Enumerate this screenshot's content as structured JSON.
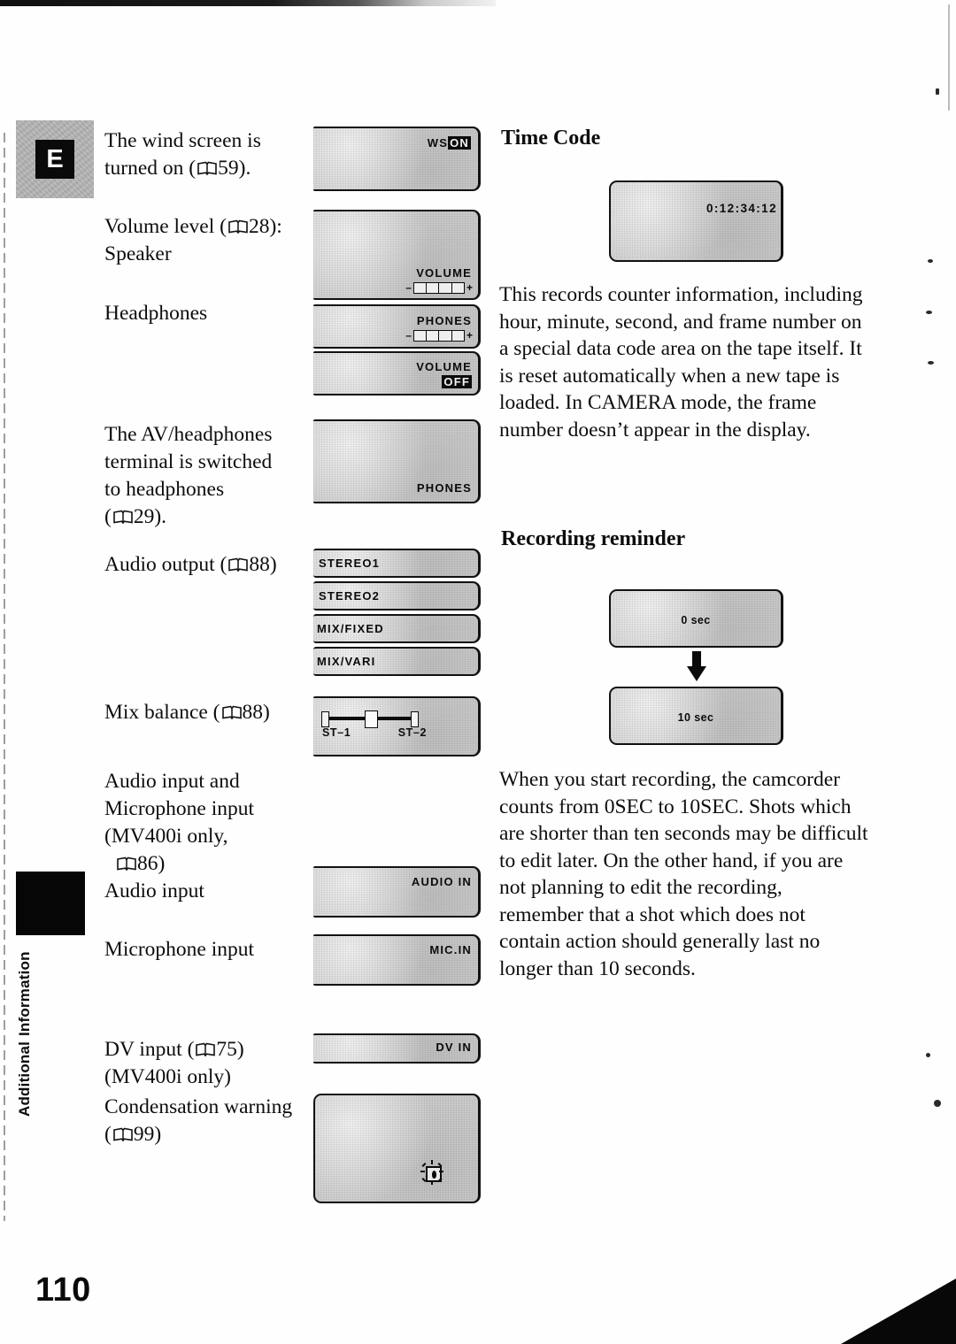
{
  "page": {
    "number": "110",
    "chapter_marker_letter": "E",
    "side_tab": {
      "line1": "Additional",
      "line2": "Information"
    }
  },
  "left_column": {
    "entries": [
      {
        "id": "wind-screen",
        "label_parts": [
          "The wind screen is",
          "turned on ("
        ],
        "page_ref": "59",
        "label_tail": ")."
      },
      {
        "id": "volume-level",
        "label_parts": [
          "Volume level ("
        ],
        "page_ref": "28",
        "label_tail": "):",
        "label_second_line": "Speaker"
      },
      {
        "id": "headphones",
        "label_parts": [
          "Headphones"
        ]
      },
      {
        "id": "av-headphones-terminal",
        "label_parts": [
          "The AV/headphones",
          "terminal is switched",
          "to headphones",
          "("
        ],
        "page_ref": "29",
        "label_tail": ")."
      },
      {
        "id": "audio-output",
        "label_parts": [
          "Audio output ("
        ],
        "page_ref": "88",
        "label_tail": ")"
      },
      {
        "id": "mix-balance",
        "label_parts": [
          "Mix balance ("
        ],
        "page_ref": "88",
        "label_tail": ")"
      },
      {
        "id": "audio-mic-input",
        "label_parts": [
          "Audio input and",
          "Microphone input",
          "(MV400i only,"
        ],
        "page_ref": "86",
        "label_tail": ")",
        "label_extra": "Audio input"
      },
      {
        "id": "microphone-input",
        "label_parts": [
          "Microphone input"
        ]
      },
      {
        "id": "dv-input",
        "label_parts": [
          "DV input ("
        ],
        "page_ref": "75",
        "label_tail": ")",
        "label_second_line": "(MV400i only)"
      },
      {
        "id": "condensation-warning",
        "label_parts": [
          "Condensation warning",
          "("
        ],
        "page_ref": "99",
        "label_tail": ")"
      }
    ],
    "screens": {
      "wind_screen": {
        "prefix": "WS",
        "state": "ON"
      },
      "volume_speaker": {
        "title": "VOLUME",
        "minus": "–",
        "plus": "+"
      },
      "headphones_level": {
        "title": "PHONES",
        "minus": "–",
        "plus": "+"
      },
      "volume_off": {
        "title": "VOLUME",
        "state": "OFF"
      },
      "phones_terminal": {
        "label": "PHONES"
      },
      "audio_output_options": [
        "STEREO1",
        "STEREO2",
        "MIX/FIXED",
        "MIX/VARI"
      ],
      "mix_balance": {
        "left": "ST–1",
        "right": "ST–2"
      },
      "audio_in": {
        "label": "AUDIO IN"
      },
      "mic_in": {
        "label": "MIC.IN"
      },
      "dv_in": {
        "label": "DV IN"
      },
      "condensation": {
        "label": ""
      }
    }
  },
  "right_column": {
    "sections": [
      {
        "id": "time-code",
        "heading": "Time Code",
        "screen_value": "0:12:34:12",
        "body": "This records counter information, including hour, minute, second, and frame number on a special data code area on the tape itself. It is reset automatically when a new tape is loaded. In CAMERA mode, the frame number doesn’t appear in the display."
      },
      {
        "id": "recording-reminder",
        "heading": "Recording reminder",
        "screen_top_value": "0 sec",
        "screen_bottom_value": "10 sec",
        "body": "When you start recording, the camcorder counts from 0SEC to 10SEC. Shots which are shorter than ten seconds may be difficult to edit later. On the other hand, if you are not planning to edit the recording, remember that a shot which does not contain action should generally last no longer than 10 seconds."
      }
    ]
  }
}
